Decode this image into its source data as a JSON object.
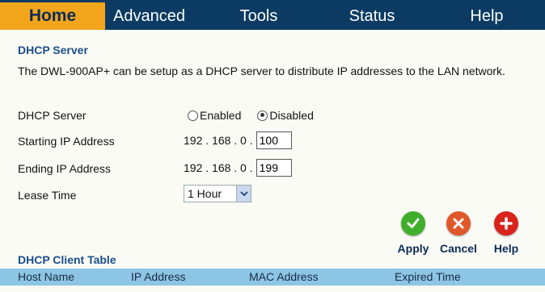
{
  "nav": {
    "tabs": [
      "Home",
      "Advanced",
      "Tools",
      "Status",
      "Help"
    ],
    "active": "Home"
  },
  "dhcp": {
    "section_title": "DHCP Server",
    "description": "The DWL-900AP+ can be setup as a DHCP server to distribute IP addresses to the LAN network.",
    "server_label": "DHCP Server",
    "option_enabled": "Enabled",
    "option_disabled": "Disabled",
    "selected": "Disabled",
    "start_label": "Starting IP Address",
    "start_prefix": "192 . 168 . 0 .",
    "start_value": "100",
    "end_label": "Ending IP Address",
    "end_prefix": "192 . 168 . 0 .",
    "end_value": "199",
    "lease_label": "Lease Time",
    "lease_value": "1 Hour"
  },
  "actions": {
    "apply": "Apply",
    "cancel": "Cancel",
    "help": "Help"
  },
  "client_table": {
    "title": "DHCP Client Table",
    "columns": [
      "Host Name",
      "IP Address",
      "MAC Address",
      "Expired Time"
    ]
  },
  "colors": {
    "nav_bg": "#0b3b63",
    "home_tab": "#f3a51c",
    "section_title": "#1b4d8c",
    "table_header": "#8cc6e4",
    "apply": "#3fae2a",
    "cancel": "#e0572a",
    "help": "#d8241c"
  },
  "icons": {
    "apply": "check-icon",
    "cancel": "x-icon",
    "help": "plus-icon",
    "dropdown": "chevron-down-icon"
  }
}
